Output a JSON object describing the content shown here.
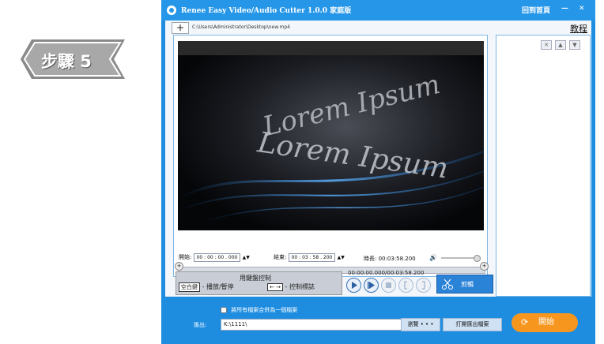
{
  "step_badge": {
    "text": "步驟 5"
  },
  "window": {
    "title": "Renee Easy Video/Audio Cutter 1.0.0 家庭版",
    "back_home": "回到首頁",
    "minimize": "—",
    "close": "✕"
  },
  "toolbar": {
    "add_label": "+",
    "file_path": "C:\\Users\\Administrator\\Desktop\\new.mp4"
  },
  "tutorial": {
    "title": "教程",
    "close": "✕",
    "up": "▲",
    "down": "▼"
  },
  "video": {
    "line1": "Lorem Ipsum",
    "line2": "Lorem Ipsum"
  },
  "range": {
    "start_label": "開始:",
    "start_value": "00 : 00 : 00 . 000",
    "end_label": "結束:",
    "end_value": "00 : 03 : 58 . 200",
    "duration_label": "時長:",
    "duration_value": "00:03:58.200"
  },
  "keyboard_hint": {
    "title": "用鍵盤控制",
    "space_key": "空白鍵",
    "space_desc": "- 播放/暫停",
    "arrow_keys": "← →",
    "arrow_desc": "- 控制標誌"
  },
  "playback": {
    "time_display": "00:00:00.000/00:03:58.200"
  },
  "cut_button": {
    "label": "剪輯"
  },
  "bottom": {
    "merge_label": "將所有檔案合併為一個檔案",
    "merge_checked": false,
    "output_label": "匯出:",
    "output_path": "K:\\1111\\",
    "browse_label": "瀏覽 • • •",
    "open_folder_label": "打開匯出檔案",
    "start_label": "開始"
  },
  "colors": {
    "window_blue": "#1e8de0",
    "start_orange": "#f7961f",
    "badge_gray": "#8a8a8a"
  }
}
